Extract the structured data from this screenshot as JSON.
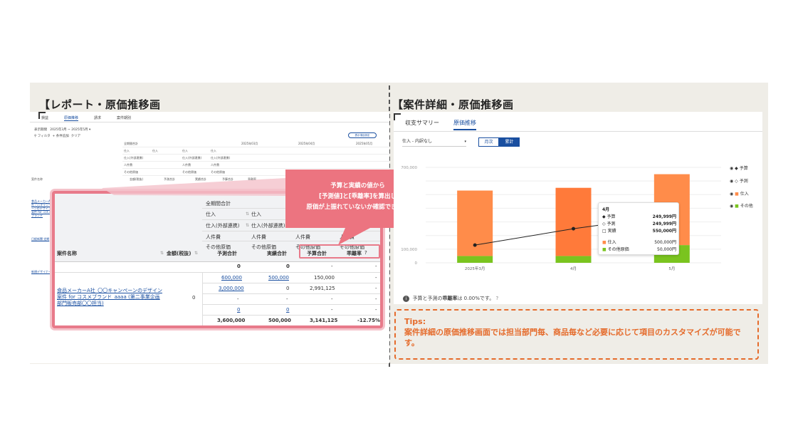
{
  "left": {
    "title": "【レポート・原価推移画",
    "tabs": [
      "損益",
      "原価推移",
      "請求",
      "案件期別"
    ],
    "period_label": "表示期間",
    "period_value": "2025年3月 ~ 2025年5月",
    "filter_label": "フィルタ",
    "add_filter": "条件追加",
    "clear": "クリア",
    "column_settings": "表示項目設定",
    "small_headers": {
      "total": "全期間合計",
      "months": [
        "2025年03月",
        "2025年04月",
        "2025年05月"
      ],
      "rows": [
        "仕入",
        "仕入(外部連携)",
        "人件費",
        "その他原価"
      ],
      "subcols": [
        "予測合計",
        "実績合計",
        "予算合計",
        "乖離率"
      ],
      "case_name": "案件名称",
      "amount": "金額(税抜)"
    },
    "small_links": [
      "食品メーカーA社 ○○キャンペーンのデザイン案件 for コスメブランド",
      "日経新聞 定期",
      "新規デザイナー"
    ],
    "zoom": {
      "total_header": "全期間合計",
      "cost_rows": [
        "仕入",
        "仕入(外部連携)",
        "人件費",
        "その他原価"
      ],
      "case_name_header": "案件名称",
      "amount_header": "金額(税抜)",
      "col_headers": [
        "予測合計",
        "実績合計",
        "予算合計",
        "乖離率"
      ],
      "zero_row": [
        "0",
        "0",
        "-",
        "-"
      ],
      "case_name": "食品メーカーA社_〇〇キャンペーンのデザイン案件 for コスメブランド_aaaa (第二事業企画部門販売部〇〇担当)",
      "amount": "0",
      "rows": [
        {
          "forecast": "600,000",
          "actual": "500,000",
          "budget": "150,000",
          "rate": "-"
        },
        {
          "forecast": "3,000,000",
          "actual": "0",
          "budget": "2,991,125",
          "rate": "-"
        },
        {
          "forecast": "-",
          "actual": "-",
          "budget": "-",
          "rate": "-"
        },
        {
          "forecast": "0",
          "actual": "0",
          "budget": "-",
          "rate": "-"
        }
      ],
      "totals": {
        "forecast": "3,600,000",
        "actual": "500,000",
        "budget": "3,141,125",
        "rate": "-12.75%"
      }
    },
    "callout": [
      "予算と実績の値から",
      "[予測値]と[乖離率]を算出し",
      "原価が上振れていないか確認できます"
    ]
  },
  "right": {
    "title": "【案件詳細・原価推移画",
    "tabs": [
      "収支サマリー",
      "原価推移"
    ],
    "select_value": "仕入 - 内訳なし",
    "toggle": [
      "月次",
      "累計"
    ],
    "legend": [
      "予算",
      "予測",
      "仕入",
      "その他"
    ],
    "tooltip": {
      "month": "4月",
      "rows": [
        {
          "label": "予算",
          "value": "249,999円"
        },
        {
          "label": "予測",
          "value": "249,999円"
        },
        {
          "label": "実績",
          "value": "550,000円"
        },
        {
          "label": "仕入",
          "value": "500,000円"
        },
        {
          "label": "その他原価",
          "value": "50,000円"
        }
      ]
    },
    "info_prefix": "予算と予測の",
    "info_bold": "乖離率",
    "info_suffix": "は 0.00%です。",
    "tips_title": "Tips:",
    "tips_text": "案件詳細の原価推移画面では担当部門毎、商品毎など必要に応じて項目のカスタマイズが可能です。"
  },
  "chart_data": {
    "type": "bar",
    "categories": [
      "2025年3月",
      "4月",
      "5月"
    ],
    "ylim": [
      0,
      700000
    ],
    "yticks": [
      "700,000",
      "100,000",
      "0"
    ],
    "series": [
      {
        "name": "その他",
        "values": [
          50000,
          50000,
          130000
        ],
        "color": "#7ac41f"
      },
      {
        "name": "仕入",
        "values": [
          480000,
          500000,
          520000
        ],
        "color": "#ff8c4a"
      }
    ],
    "line": {
      "name": "予算",
      "values": [
        130000,
        249999,
        350000
      ]
    }
  }
}
